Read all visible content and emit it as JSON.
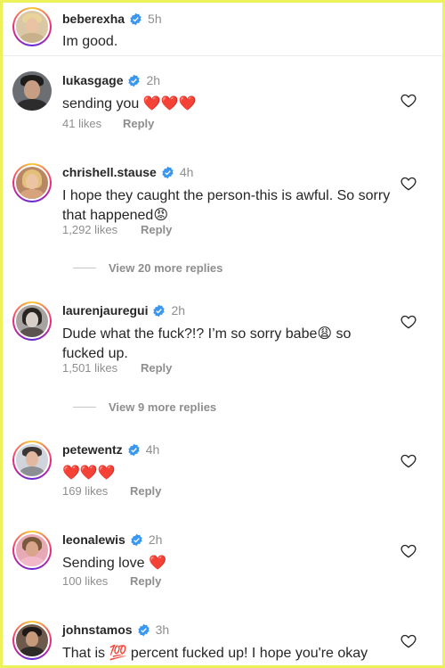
{
  "comments": [
    {
      "username": "beberexha",
      "time": "5h",
      "text": "Im good.",
      "likes": "",
      "reply": ""
    },
    {
      "username": "lukasgage",
      "time": "2h",
      "text": "sending you ❤️❤️❤️",
      "likes": "41 likes",
      "reply": "Reply"
    },
    {
      "username": "chrishell.stause",
      "time": "4h",
      "text": "I hope they caught the person-this is awful. So sorry that happened😡",
      "likes": "1,292 likes",
      "reply": "Reply"
    },
    {
      "username": "laurenjauregui",
      "time": "2h",
      "text": "Dude what the fuck?!? I’m so sorry babe😩 so fucked up.",
      "likes": "1,501 likes",
      "reply": "Reply"
    },
    {
      "username": "petewentz",
      "time": "4h",
      "text": "❤️❤️❤️",
      "likes": "169 likes",
      "reply": "Reply"
    },
    {
      "username": "leonalewis",
      "time": "2h",
      "text": "Sending love ❤️",
      "likes": "100 likes",
      "reply": "Reply"
    },
    {
      "username": "johnstamos",
      "time": "3h",
      "text": "That is 💯 percent fucked up!  I hope you're okay BeBe xo",
      "likes": "",
      "reply": ""
    }
  ],
  "view_replies": [
    {
      "label": "View 20 more replies"
    },
    {
      "label": "View 9 more replies"
    }
  ],
  "icons": {
    "verified": "verified-badge-icon",
    "heart": "heart-outline-icon"
  },
  "colors": {
    "verified": "#3897f0",
    "secondary_text": "#8e8e8e",
    "frame": "#eef25a"
  }
}
